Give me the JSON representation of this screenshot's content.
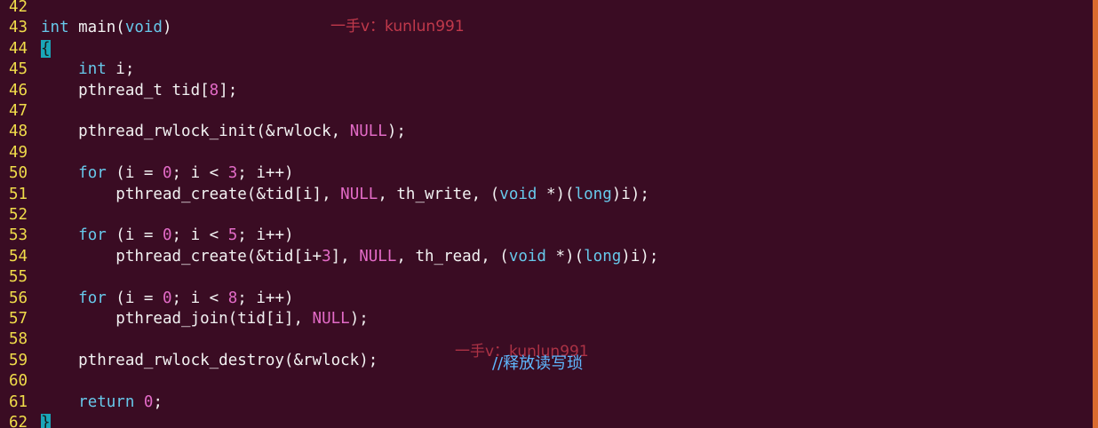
{
  "editor": {
    "lines": [
      {
        "n": "42",
        "segs": []
      },
      {
        "n": "43",
        "segs": [
          [
            "kw",
            "int"
          ],
          [
            "t",
            " main("
          ],
          [
            "kw",
            "void"
          ],
          [
            "t",
            ")"
          ]
        ]
      },
      {
        "n": "44",
        "segs": [
          [
            "hl",
            "{"
          ]
        ]
      },
      {
        "n": "45",
        "segs": [
          [
            "t",
            "    "
          ],
          [
            "kw",
            "int"
          ],
          [
            "t",
            " i;"
          ]
        ]
      },
      {
        "n": "46",
        "segs": [
          [
            "t",
            "    pthread_t tid["
          ],
          [
            "num",
            "8"
          ],
          [
            "t",
            "];"
          ]
        ]
      },
      {
        "n": "47",
        "segs": []
      },
      {
        "n": "48",
        "segs": [
          [
            "t",
            "    pthread_rwlock_init(&rwlock, "
          ],
          [
            "nul",
            "NULL"
          ],
          [
            "t",
            ");"
          ]
        ]
      },
      {
        "n": "49",
        "segs": []
      },
      {
        "n": "50",
        "segs": [
          [
            "t",
            "    "
          ],
          [
            "kw",
            "for"
          ],
          [
            "t",
            " (i = "
          ],
          [
            "num",
            "0"
          ],
          [
            "t",
            "; i < "
          ],
          [
            "num",
            "3"
          ],
          [
            "t",
            "; i++)"
          ]
        ]
      },
      {
        "n": "51",
        "segs": [
          [
            "t",
            "        pthread_create(&tid[i], "
          ],
          [
            "nul",
            "NULL"
          ],
          [
            "t",
            ", th_write, ("
          ],
          [
            "kw",
            "void"
          ],
          [
            "t",
            " *)("
          ],
          [
            "kw",
            "long"
          ],
          [
            "t",
            ")i);"
          ]
        ]
      },
      {
        "n": "52",
        "segs": []
      },
      {
        "n": "53",
        "segs": [
          [
            "t",
            "    "
          ],
          [
            "kw",
            "for"
          ],
          [
            "t",
            " (i = "
          ],
          [
            "num",
            "0"
          ],
          [
            "t",
            "; i < "
          ],
          [
            "num",
            "5"
          ],
          [
            "t",
            "; i++)"
          ]
        ]
      },
      {
        "n": "54",
        "segs": [
          [
            "t",
            "        pthread_create(&tid[i+"
          ],
          [
            "num",
            "3"
          ],
          [
            "t",
            "], "
          ],
          [
            "nul",
            "NULL"
          ],
          [
            "t",
            ", th_read, ("
          ],
          [
            "kw",
            "void"
          ],
          [
            "t",
            " *)("
          ],
          [
            "kw",
            "long"
          ],
          [
            "t",
            ")i);"
          ]
        ]
      },
      {
        "n": "55",
        "segs": []
      },
      {
        "n": "56",
        "segs": [
          [
            "t",
            "    "
          ],
          [
            "kw",
            "for"
          ],
          [
            "t",
            " (i = "
          ],
          [
            "num",
            "0"
          ],
          [
            "t",
            "; i < "
          ],
          [
            "num",
            "8"
          ],
          [
            "t",
            "; i++)"
          ]
        ]
      },
      {
        "n": "57",
        "segs": [
          [
            "t",
            "        pthread_join(tid[i], "
          ],
          [
            "nul",
            "NULL"
          ],
          [
            "t",
            ");"
          ]
        ]
      },
      {
        "n": "58",
        "segs": []
      },
      {
        "n": "59",
        "segs": [
          [
            "t",
            "    pthread_rwlock_destroy(&rwlock);"
          ]
        ]
      },
      {
        "n": "60",
        "segs": []
      },
      {
        "n": "61",
        "segs": [
          [
            "t",
            "    "
          ],
          [
            "kw",
            "return"
          ],
          [
            "t",
            " "
          ],
          [
            "num",
            "0"
          ],
          [
            "t",
            ";"
          ]
        ]
      },
      {
        "n": "62",
        "segs": [
          [
            "hl",
            "}"
          ]
        ]
      }
    ]
  },
  "watermarks": {
    "top": "一手v：kunlun991",
    "middle": "一手v：kunlun991"
  },
  "annotation": {
    "comment": "//释放读写琐"
  },
  "colors": {
    "background": "#3a0c23",
    "line_numbers": "#f0dc4a",
    "keyword": "#67c8ea",
    "constant": "#e36bc7",
    "cursor": "#1aa6b8",
    "scrollbar_edge": "#d96b2f"
  }
}
